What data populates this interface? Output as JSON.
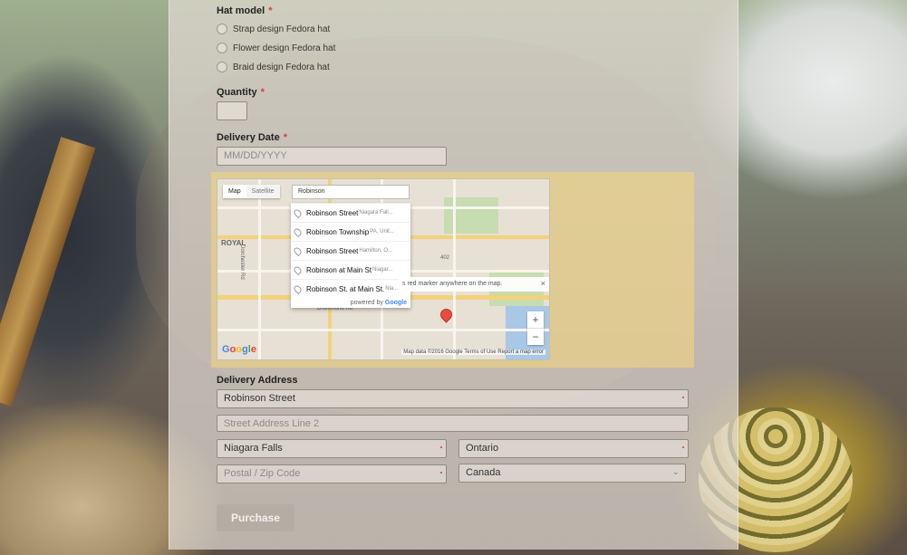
{
  "form": {
    "hat_model": {
      "label": "Hat model",
      "required_mark": "*",
      "options": [
        "Strap design Fedora hat",
        "Flower design Fedora hat",
        "Braid design Fedora hat"
      ]
    },
    "quantity": {
      "label": "Quantity",
      "required_mark": "*",
      "value": ""
    },
    "delivery_date": {
      "label": "Delivery Date",
      "required_mark": "*",
      "placeholder": "MM/DD/YYYY"
    },
    "map": {
      "tab_map": "Map",
      "tab_satellite": "Satellite",
      "search_value": "Robinson",
      "suggestions": [
        {
          "main": "Robinson Street",
          "sub": "Niagara Fall..."
        },
        {
          "main": "Robinson Township",
          "sub": "PA, Unit..."
        },
        {
          "main": "Robinson Street",
          "sub": "Hamilton, O..."
        },
        {
          "main": "Robinson at Main St",
          "sub": "Niagar..."
        },
        {
          "main": "Robinson St. at Main St.",
          "sub": "Nia..."
        }
      ],
      "powered_by": "powered by",
      "powered_brand": "Google",
      "tip": "s red marker anywhere on the map.",
      "tip_close": "×",
      "zoom_in": "+",
      "zoom_out": "−",
      "logo": "Google",
      "credits": "Map data ©2016 Google   Terms of Use   Report a map error",
      "street_labels": [
        "ROYAL",
        "Dorchester Rd",
        "Drummond Rd",
        "402",
        "420"
      ]
    },
    "delivery_address": {
      "label": "Delivery Address",
      "street_line_1": "Robinson Street",
      "street_line_2_placeholder": "Street Address Line 2",
      "city": "Niagara Falls",
      "state": "Ontario",
      "postal_placeholder": "Postal / Zip Code",
      "country": "Canada"
    },
    "submit_label": "Purchase"
  }
}
